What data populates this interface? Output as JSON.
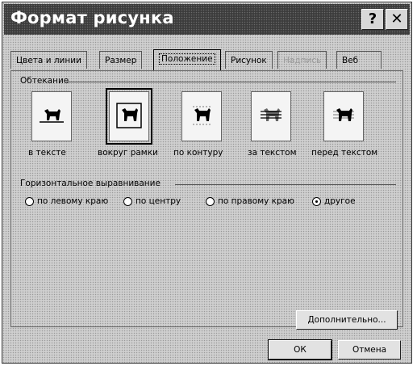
{
  "window": {
    "title": "Формат рисунка",
    "help_label": "?",
    "close_label": "✕"
  },
  "tabs": [
    {
      "label": "Цвета и линии"
    },
    {
      "label": "Размер"
    },
    {
      "label": "Положение"
    },
    {
      "label": "Рисунок"
    },
    {
      "label": "Надпись"
    },
    {
      "label": "Веб"
    }
  ],
  "wrapping": {
    "group_label": "Обтекание",
    "options": [
      {
        "label": "в тексте"
      },
      {
        "label": "вокруг рамки"
      },
      {
        "label": "по контуру"
      },
      {
        "label": "за текстом"
      },
      {
        "label": "перед текстом"
      }
    ]
  },
  "horizontal_alignment": {
    "group_label": "Горизонтальное выравнивание",
    "options": [
      {
        "label": "по левому краю"
      },
      {
        "label": "по центру"
      },
      {
        "label": "по правому краю"
      },
      {
        "label": "другое"
      }
    ]
  },
  "buttons": {
    "advanced": "Дополнительно...",
    "ok": "ОК",
    "cancel": "Отмена"
  }
}
